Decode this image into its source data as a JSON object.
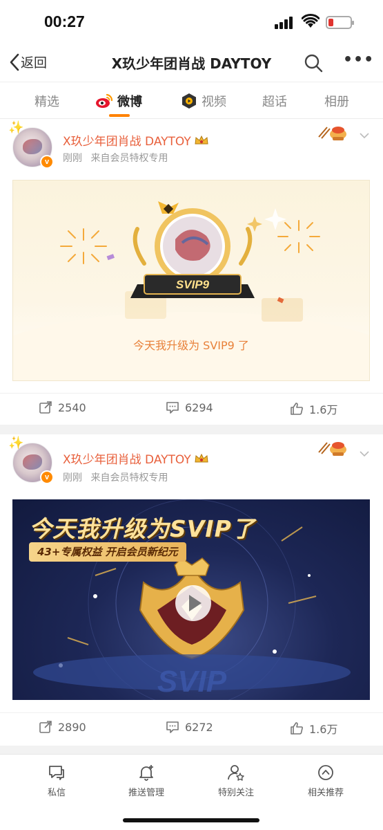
{
  "status": {
    "time": "00:27"
  },
  "nav": {
    "back_label": "返回",
    "title": "X玖少年团肖战 DAYTOY"
  },
  "tabs": [
    {
      "label": "精选"
    },
    {
      "label": "微博",
      "active": true
    },
    {
      "label": "视频"
    },
    {
      "label": "超话"
    },
    {
      "label": "相册"
    }
  ],
  "posts": [
    {
      "user_name": "X玖少年团肖战 DAYTOY",
      "time": "刚刚",
      "source": "来自会员特权专用",
      "image_caption": "今天我升级为 SVIP9 了",
      "badge_text": "SVIP9",
      "reposts": "2540",
      "comments": "6294",
      "likes": "1.6万"
    },
    {
      "user_name": "X玖少年团肖战 DAYTOY",
      "time": "刚刚",
      "source": "来自会员特权专用",
      "promo_title": "今天我升级为SVIP了",
      "promo_subtitle": "43+专属权益  开启会员新纪元",
      "reposts": "2890",
      "comments": "6272",
      "likes": "1.6万"
    }
  ],
  "bottom_bar": [
    {
      "label": "私信",
      "icon": "message-icon"
    },
    {
      "label": "推送管理",
      "icon": "bell-icon"
    },
    {
      "label": "特别关注",
      "icon": "user-star-icon"
    },
    {
      "label": "相关推荐",
      "icon": "compass-icon"
    }
  ],
  "colors": {
    "accent_orange": "#ff8200",
    "user_name": "#e8603c",
    "battery_low": "#e0342f",
    "promo_bg": "#1d2756"
  }
}
